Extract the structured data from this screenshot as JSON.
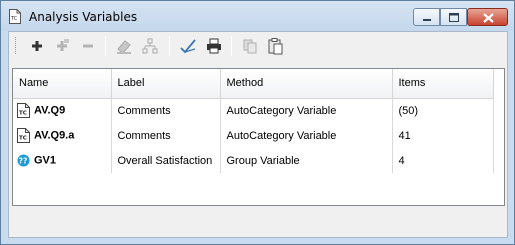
{
  "window": {
    "title": "Analysis Variables",
    "icons": {
      "title": "tc-document-icon",
      "minimize": "minimize-icon",
      "maximize": "maximize-icon",
      "close": "close-icon"
    }
  },
  "toolbar": {
    "buttons": [
      {
        "name": "add-button",
        "icon": "plus-icon",
        "enabled": true
      },
      {
        "name": "add-copy-button",
        "icon": "plus-icon",
        "enabled": false
      },
      {
        "name": "remove-button",
        "icon": "minus-icon",
        "enabled": false
      },
      {
        "name": "edit-button",
        "icon": "eraser-icon",
        "enabled": false
      },
      {
        "name": "hierarchy-button",
        "icon": "hierarchy-icon",
        "enabled": false
      },
      {
        "name": "check-button",
        "icon": "checkmark-pen-icon",
        "enabled": true
      },
      {
        "name": "print-button",
        "icon": "printer-icon",
        "enabled": true
      },
      {
        "name": "copy-button",
        "icon": "copy-icon",
        "enabled": false
      },
      {
        "name": "paste-button",
        "icon": "clipboard-icon",
        "enabled": true
      }
    ]
  },
  "table": {
    "columns": [
      "Name",
      "Label",
      "Method",
      "Items"
    ],
    "rows": [
      {
        "icon": "tc-document-icon",
        "name": "AV.Q9",
        "label": "Comments",
        "method": "AutoCategory Variable",
        "items": "(50)"
      },
      {
        "icon": "tc-document-icon",
        "name": "AV.Q9.a",
        "label": "Comments",
        "method": "AutoCategory Variable",
        "items": "41"
      },
      {
        "icon": "question-circle-icon",
        "name": "GV1",
        "label": "Overall Satisfaction",
        "method": "Group Variable",
        "items": "4"
      }
    ]
  },
  "colors": {
    "frame": "#c9dbef",
    "close_button": "#c8432f",
    "question_icon": "#1e9bd7"
  }
}
